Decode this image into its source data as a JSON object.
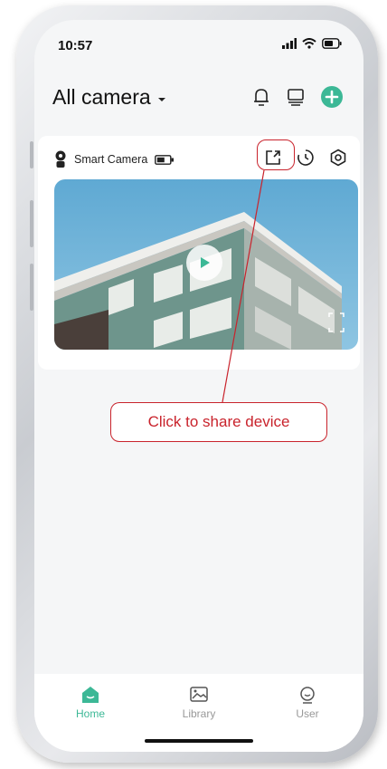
{
  "status_bar": {
    "time": "10:57",
    "icons": [
      "signal-icon",
      "wifi-icon",
      "battery-icon"
    ]
  },
  "header": {
    "title": "All camera",
    "icons": [
      "bell-icon",
      "multi-screen-icon",
      "add-icon"
    ]
  },
  "camera_card": {
    "name": "Smart Camera",
    "actions": [
      "share-icon",
      "history-icon",
      "settings-icon"
    ]
  },
  "annotation": {
    "text": "Click to share device"
  },
  "tabs": [
    {
      "label": "Home",
      "active": true
    },
    {
      "label": "Library",
      "active": false
    },
    {
      "label": "User",
      "active": false
    }
  ],
  "colors": {
    "accent": "#3cb896",
    "annotation": "#c9232c"
  }
}
